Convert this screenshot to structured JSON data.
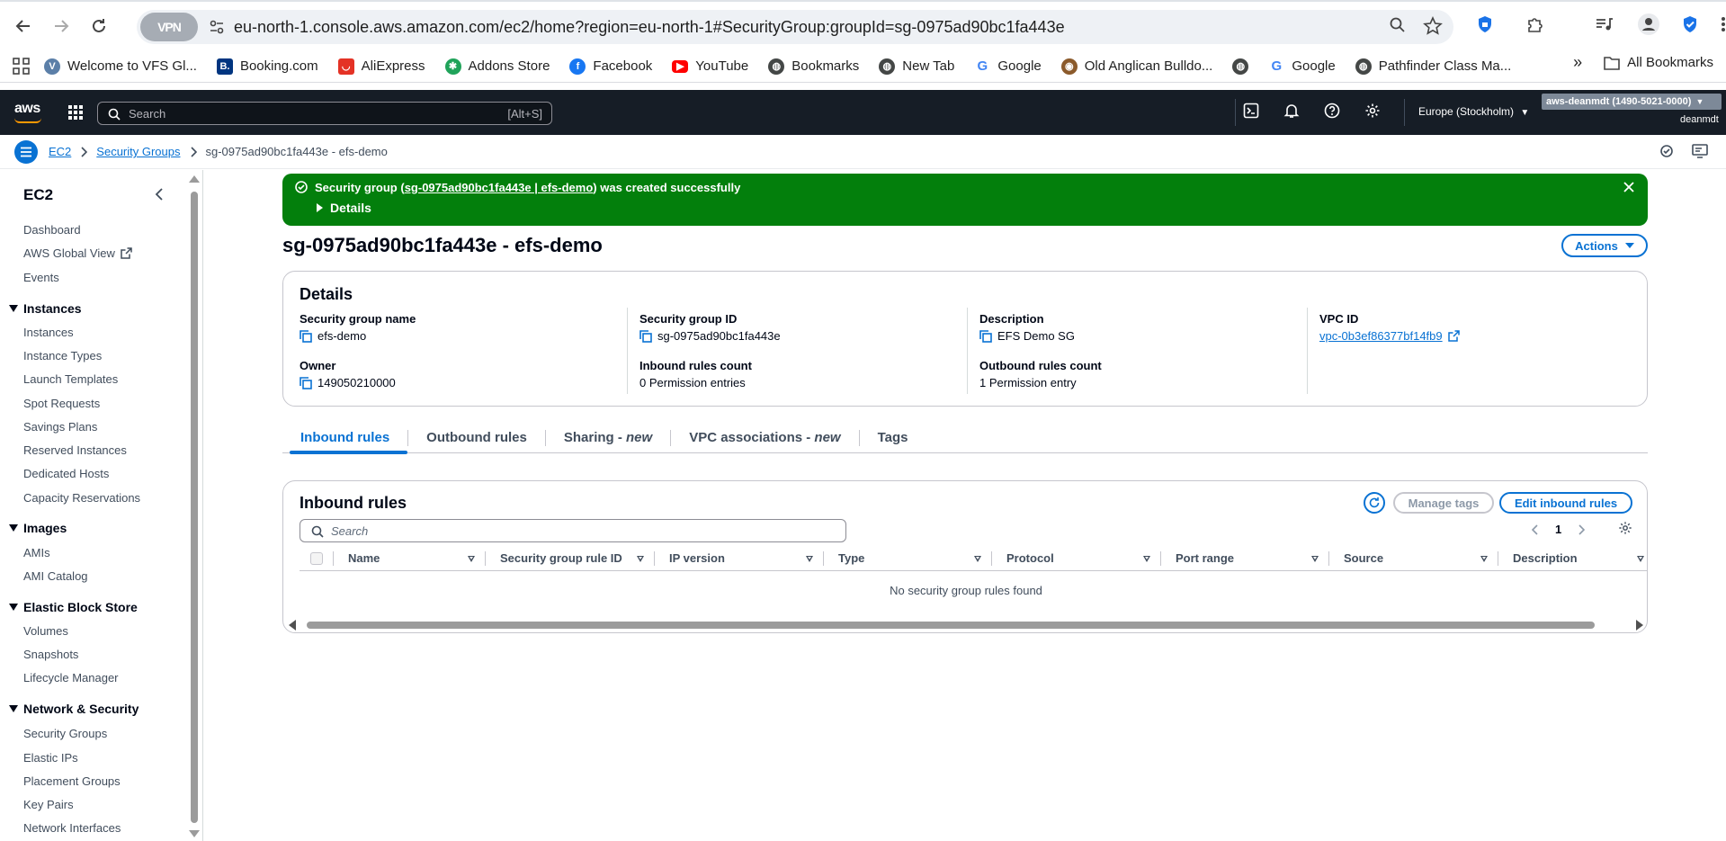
{
  "browser": {
    "url": "eu-north-1.console.aws.amazon.com/ec2/home?region=eu-north-1#SecurityGroup:groupId=sg-0975ad90bc1fa443e",
    "vpn_label": "VPN",
    "bookmarks": [
      {
        "label": "Welcome to VFS Gl...",
        "icon": "vfs-globe-icon",
        "color": "#5b7fa8"
      },
      {
        "label": "Booking.com",
        "icon": "booking-icon",
        "color": "#003580"
      },
      {
        "label": "AliExpress",
        "icon": "aliexpress-icon",
        "color": "#e43225"
      },
      {
        "label": "Addons Store",
        "icon": "addons-icon",
        "color": "#20a35a"
      },
      {
        "label": "Facebook",
        "icon": "facebook-icon",
        "color": "#1877f2"
      },
      {
        "label": "YouTube",
        "icon": "youtube-icon",
        "color": "#ff0000"
      },
      {
        "label": "Bookmarks",
        "icon": "globe-icon",
        "color": "#444746"
      },
      {
        "label": "New Tab",
        "icon": "globe-icon",
        "color": "#444746"
      },
      {
        "label": "Google",
        "icon": "google-icon",
        "color": "#4285f4"
      },
      {
        "label": "Old Anglican Bulldo...",
        "icon": "dog-icon",
        "color": "#8b5a2b"
      },
      {
        "label": "",
        "icon": "globe-icon",
        "color": "#444746"
      },
      {
        "label": "Google",
        "icon": "google-icon",
        "color": "#4285f4"
      },
      {
        "label": "Pathfinder Class Ma...",
        "icon": "globe-icon",
        "color": "#444746"
      }
    ],
    "all_bookmarks": "All Bookmarks"
  },
  "aws_header": {
    "logo": "aws",
    "search_placeholder": "Search",
    "search_shortcut": "[Alt+S]",
    "region": "Europe (Stockholm)",
    "account": "aws-deanmdt (1490-5021-0000)",
    "user": "deanmdt"
  },
  "breadcrumb": {
    "ec2": "EC2",
    "security_groups": "Security Groups",
    "current": "sg-0975ad90bc1fa443e - efs-demo"
  },
  "sidebar": {
    "title": "EC2",
    "top_items": [
      "Dashboard",
      "AWS Global View",
      "Events"
    ],
    "sections": [
      {
        "title": "Instances",
        "items": [
          "Instances",
          "Instance Types",
          "Launch Templates",
          "Spot Requests",
          "Savings Plans",
          "Reserved Instances",
          "Dedicated Hosts",
          "Capacity Reservations"
        ]
      },
      {
        "title": "Images",
        "items": [
          "AMIs",
          "AMI Catalog"
        ]
      },
      {
        "title": "Elastic Block Store",
        "items": [
          "Volumes",
          "Snapshots",
          "Lifecycle Manager"
        ]
      },
      {
        "title": "Network & Security",
        "items": [
          "Security Groups",
          "Elastic IPs",
          "Placement Groups",
          "Key Pairs",
          "Network Interfaces"
        ]
      }
    ]
  },
  "flash": {
    "prefix": "Security group (",
    "link": "sg-0975ad90bc1fa443e | efs-demo",
    "suffix": ") was created successfully",
    "details": "Details",
    "color": "#037f0c"
  },
  "page": {
    "title": "sg-0975ad90bc1fa443e - efs-demo",
    "actions": "Actions"
  },
  "details": {
    "heading": "Details",
    "sg_name_label": "Security group name",
    "sg_name": "efs-demo",
    "sg_id_label": "Security group ID",
    "sg_id": "sg-0975ad90bc1fa443e",
    "desc_label": "Description",
    "desc": "EFS Demo SG",
    "vpc_label": "VPC ID",
    "vpc": "vpc-0b3ef86377bf14fb9",
    "owner_label": "Owner",
    "owner": "149050210000",
    "inbound_label": "Inbound rules count",
    "inbound": "0 Permission entries",
    "outbound_label": "Outbound rules count",
    "outbound": "1 Permission entry"
  },
  "tabs": {
    "inbound": "Inbound rules",
    "outbound": "Outbound rules",
    "sharing": "Sharing - ",
    "sharing_new": "new",
    "vpc_assoc": "VPC associations - ",
    "vpc_assoc_new": "new",
    "tags": "Tags"
  },
  "rules": {
    "title": "Inbound rules",
    "manage_tags": "Manage tags",
    "edit": "Edit inbound rules",
    "search_placeholder": "Search",
    "page": "1",
    "columns": [
      "Name",
      "Security group rule ID",
      "IP version",
      "Type",
      "Protocol",
      "Port range",
      "Source",
      "Description"
    ],
    "empty": "No security group rules found"
  },
  "colors": {
    "accent": "#0972d3",
    "header_bg": "#161d26",
    "success": "#037f0c"
  }
}
